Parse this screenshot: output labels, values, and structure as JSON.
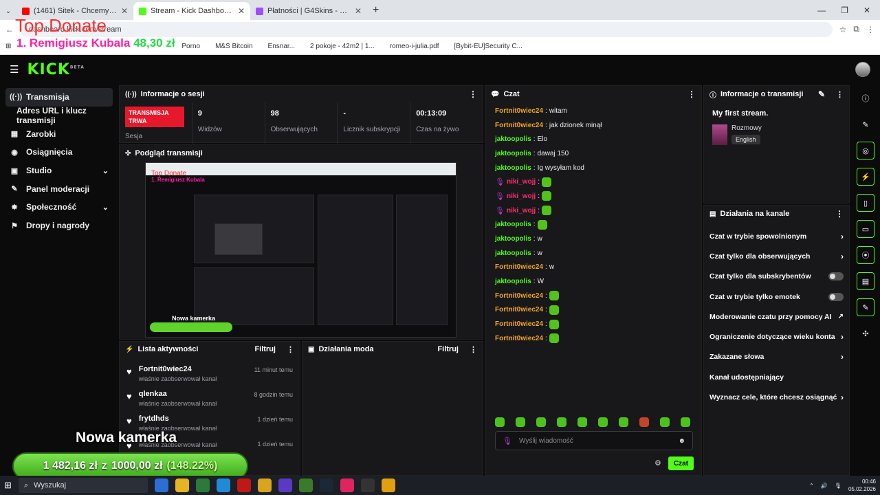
{
  "browser": {
    "tabs": [
      {
        "title": "(1461) Sitek - Chcemy Być Wła...",
        "color": "#ff0000",
        "active": false
      },
      {
        "title": "Stream - Kick Dashboard",
        "color": "#53fc18",
        "active": true
      },
      {
        "title": "Płatności | G4Skins - Otwieraj skr...",
        "color": "#9b4dff",
        "active": false
      }
    ],
    "url": "dashboard.kick.com/stream",
    "bookmarks": [
      "Porno",
      "M&S Bitcoin",
      "Ensnar...",
      "2 pokoje - 42m2 | 1...",
      "romeo-i-julia.pdf",
      "[Bybit-EU]Security C..."
    ]
  },
  "overlay": {
    "top_donate_title": "Top Donate",
    "top_donor": "1. Remigiusz Kubala",
    "top_amount": "48,30 zł",
    "camera_text": "Nowa kamerka",
    "goal_current": "1 482,16 zł",
    "goal_sep": "z",
    "goal_target": "1000,00 zł",
    "goal_percent": "(148.22%)"
  },
  "kick": {
    "logo": "KICK",
    "logo_badge": "BETA"
  },
  "sidebar": {
    "items": [
      {
        "label": "Transmisja",
        "icon": "broadcast-icon",
        "glyph": "((·))"
      },
      {
        "label": "Adres URL i klucz transmisji",
        "icon": "",
        "glyph": ""
      },
      {
        "label": "Zarobki",
        "icon": "earnings-icon",
        "glyph": "▦"
      },
      {
        "label": "Osiągnięcia",
        "icon": "achievements-icon",
        "glyph": "◉"
      },
      {
        "label": "Studio",
        "icon": "studio-icon",
        "glyph": "▣"
      },
      {
        "label": "Panel moderacji",
        "icon": "moderation-icon",
        "glyph": "✎"
      },
      {
        "label": "Społeczność",
        "icon": "community-icon",
        "glyph": "✸"
      },
      {
        "label": "Dropy i nagrody",
        "icon": "drops-icon",
        "glyph": "⚑"
      }
    ]
  },
  "session": {
    "title": "Informacje o sesji",
    "status": "TRANSMISJA TRWA",
    "status_sub": "Sesja",
    "viewers_value": "9",
    "viewers_label": "Widzów",
    "followers_value": "98",
    "followers_label": "Obserwujących",
    "subs_value": "-",
    "subs_label": "Licznik subskrypcji",
    "live_value": "00:13:09",
    "live_label": "Czas na żywo"
  },
  "preview": {
    "title": "Podgląd transmisji"
  },
  "activity": {
    "title": "Lista aktywności",
    "filter": "Filtruj",
    "items": [
      {
        "user": "Fortnit0wiec24",
        "action": "właśnie zaobserwował kanał",
        "time": "11 minut temu"
      },
      {
        "user": "qlenkaa",
        "action": "właśnie zaobserwował kanał",
        "time": "8 godzin temu"
      },
      {
        "user": "frytdhds",
        "action": "właśnie zaobserwował kanał",
        "time": "1 dzień temu"
      },
      {
        "user": "",
        "action": "właśnie zaobserwował kanał",
        "time": "1 dzień temu"
      }
    ]
  },
  "mod_actions": {
    "title": "Działania moda",
    "filter": "Filtruj"
  },
  "chat": {
    "title": "Czat",
    "messages": [
      {
        "user": "Fortnit0wiec24",
        "text": "witam",
        "color": "#f5a623",
        "emotes": 0,
        "mic": false
      },
      {
        "user": "Fortnit0wiec24",
        "text": "jak dzionek minął",
        "color": "#f5a623",
        "emotes": 0,
        "mic": false
      },
      {
        "user": "jaktoopolis",
        "text": "Elo",
        "color": "#53fc18",
        "emotes": 0,
        "mic": false
      },
      {
        "user": "jaktoopolis",
        "text": "dawaj 150",
        "color": "#53fc18",
        "emotes": 0,
        "mic": false
      },
      {
        "user": "jaktoopolis",
        "text": "Ig wysyłam kod",
        "color": "#53fc18",
        "emotes": 0,
        "mic": false
      },
      {
        "user": "niki_wojj",
        "text": "",
        "color": "#ff2b6b",
        "emotes": 1,
        "mic": true
      },
      {
        "user": "niki_wojj",
        "text": "",
        "color": "#ff2b6b",
        "emotes": 1,
        "mic": true
      },
      {
        "user": "niki_wojj",
        "text": "",
        "color": "#ff2b6b",
        "emotes": 1,
        "mic": true
      },
      {
        "user": "jaktoopolis",
        "text": "",
        "color": "#53fc18",
        "emotes": 1,
        "mic": false
      },
      {
        "user": "jaktoopolis",
        "text": "w",
        "color": "#53fc18",
        "emotes": 0,
        "mic": false
      },
      {
        "user": "jaktoopolis",
        "text": "w",
        "color": "#53fc18",
        "emotes": 0,
        "mic": false
      },
      {
        "user": "Fortnit0wiec24",
        "text": "w",
        "color": "#f5a623",
        "emotes": 0,
        "mic": false
      },
      {
        "user": "jaktoopolis",
        "text": "W",
        "color": "#53fc18",
        "emotes": 0,
        "mic": false
      },
      {
        "user": "Fortnit0wiec24",
        "text": "",
        "color": "#f5a623",
        "emotes": 1,
        "mic": false
      },
      {
        "user": "Fortnit0wiec24",
        "text": "",
        "color": "#f5a623",
        "emotes": 1,
        "mic": false
      },
      {
        "user": "Fortnit0wiec24",
        "text": "",
        "color": "#f5a623",
        "emotes": 1,
        "mic": false
      },
      {
        "user": "Fortnit0wiec24",
        "text": "",
        "color": "#f5a623",
        "emotes": 1,
        "mic": false
      }
    ],
    "input_placeholder": "Wyślij wiadomość",
    "send_label": "Czat"
  },
  "stream_info": {
    "title": "Informacje o transmisji",
    "stream_title": "My first stream.",
    "category": "Rozmowy",
    "language": "English"
  },
  "channel_actions": {
    "title": "Działania na kanale",
    "items": [
      {
        "label": "Czat w trybie spowolnionym",
        "kind": "arrow"
      },
      {
        "label": "Czat tylko dla obserwujących",
        "kind": "arrow"
      },
      {
        "label": "Czat tylko dla subskrybentów",
        "kind": "toggle"
      },
      {
        "label": "Czat w trybie tylko emotek",
        "kind": "toggle"
      },
      {
        "label": "Moderowanie czatu przy pomocy AI",
        "kind": "external"
      },
      {
        "label": "Ograniczenie dotyczące wieku konta",
        "kind": "arrow"
      },
      {
        "label": "Zakazane słowa",
        "kind": "arrow"
      },
      {
        "label": "Kanał udostępniający",
        "kind": "none"
      },
      {
        "label": "Wyznacz cele, które chcesz osiągnąć",
        "kind": "arrow"
      }
    ]
  },
  "taskbar": {
    "search": "Wyszukaj",
    "time": "00:46",
    "date": "05.02.2026"
  },
  "colors": {
    "accent": "#53fc18",
    "live": "#e8182c"
  }
}
